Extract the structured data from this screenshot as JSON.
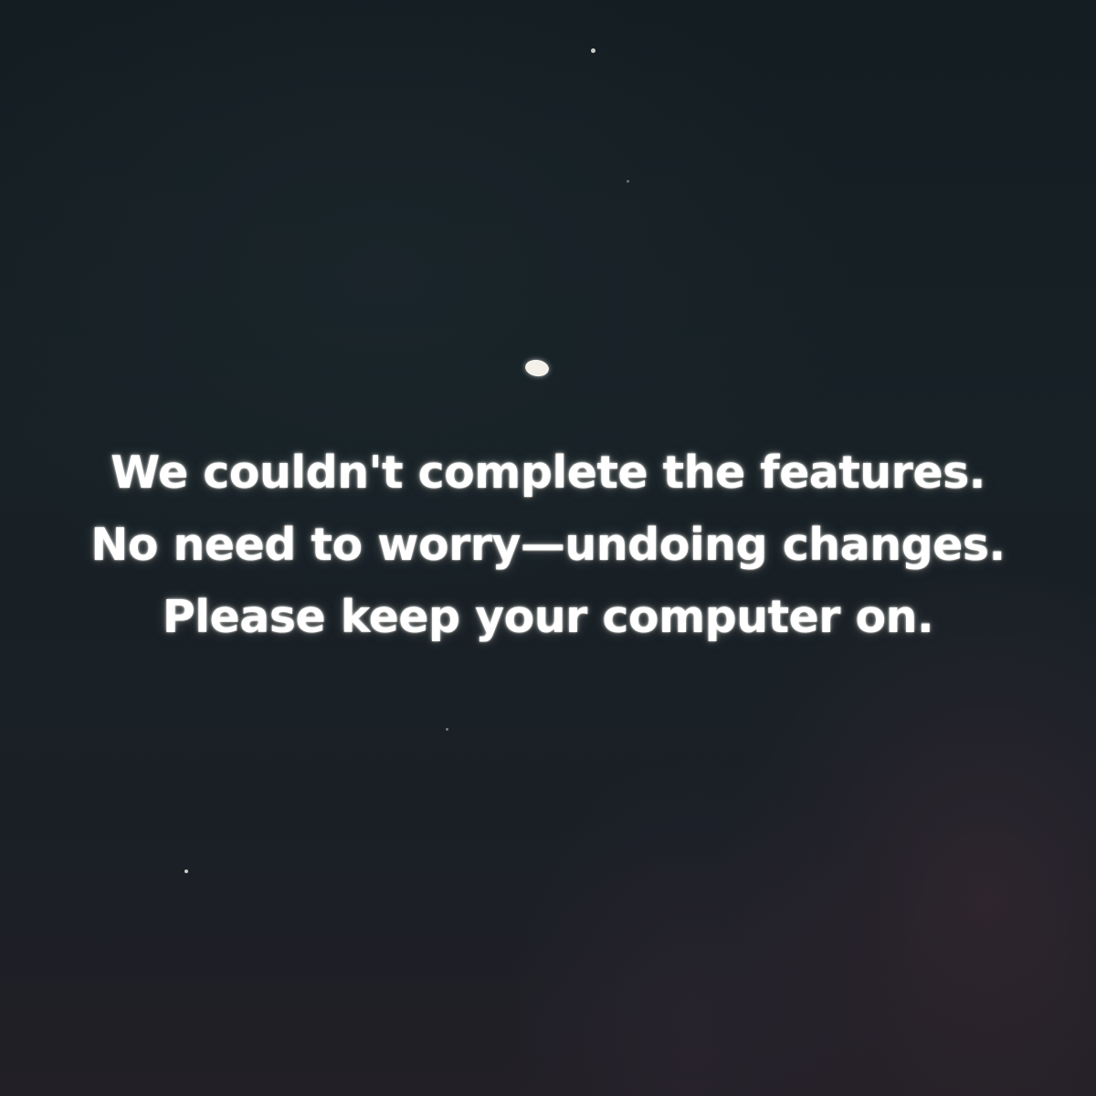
{
  "status_message": {
    "line1": "We couldn't complete the features.",
    "line2": "No need to worry—undoing changes.",
    "line3": "Please keep your computer on."
  },
  "progress_indicator": {
    "icon": "spinner-dot-icon",
    "color": "#f4f1ea"
  },
  "colors": {
    "background": "#172126",
    "text": "#ffffff"
  }
}
